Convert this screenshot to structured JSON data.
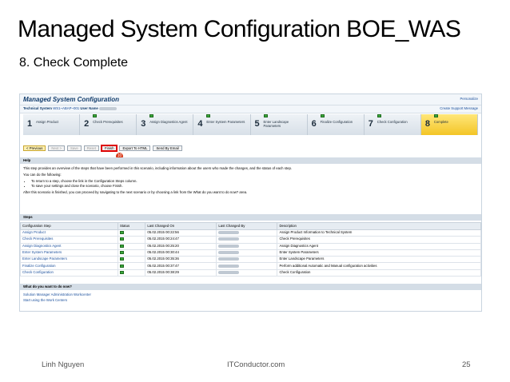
{
  "slide": {
    "title": "Managed System Configuration BOE_WAS",
    "subtitle": "8. Check Complete",
    "footer_left": "Linh Nguyen",
    "footer_center": "ITConductor.com",
    "page_number": "25"
  },
  "app": {
    "title": "Managed System Configuration",
    "personalize": "Personalize",
    "tech_system_label": "Technical System",
    "tech_system_value": "WS1~ABAP~001",
    "user_name_label": "User Name",
    "create_support_message": "Create Support Message"
  },
  "roadmap": [
    {
      "num": "1",
      "label": "Assign Product",
      "done": false,
      "active": false
    },
    {
      "num": "2",
      "label": "Check Prerequisites",
      "done": true,
      "active": false
    },
    {
      "num": "3",
      "label": "Assign Diagnostics Agent",
      "done": true,
      "active": false
    },
    {
      "num": "4",
      "label": "Enter System Parameters",
      "done": true,
      "active": false
    },
    {
      "num": "5",
      "label": "Enter Landscape Parameters",
      "done": true,
      "active": false
    },
    {
      "num": "6",
      "label": "Finalize Configuration",
      "done": true,
      "active": false
    },
    {
      "num": "7",
      "label": "Check Configuration",
      "done": true,
      "active": false
    },
    {
      "num": "8",
      "label": "Complete",
      "done": true,
      "active": true
    }
  ],
  "toolbar": {
    "previous": "< Previous",
    "next": "Next >",
    "save": "Save",
    "reset": "Reset",
    "finish": "Finish",
    "export_html": "Export To HTML",
    "send_email": "Send By Email"
  },
  "callout_number": "10",
  "help": {
    "section_title": "Help",
    "p1": "This step provides an overview of the steps that have been performed in this scenario, including information about the users who made the changes, and the status of each step.",
    "p2": "You can do the following:",
    "bullet1": "To return to a step, choose the link in the Configuration Steps column.",
    "bullet2": "To save your settings and close the scenario, choose Finish.",
    "p3": "After this scenario is finished, you can proceed by navigating to the next scenario or by choosing a link from the What do you want to do now? area."
  },
  "steps": {
    "section_title": "Steps",
    "columns": [
      "Configuration Step",
      "Status",
      "Last Changed On",
      "Last Changed By",
      "Description"
    ],
    "rows": [
      {
        "step": "Assign Product",
        "changed_on": "05.02.2015 00:22:56",
        "description": "Assign Product Information to Technical System"
      },
      {
        "step": "Check Prerequisites",
        "changed_on": "05.02.2015 00:24:47",
        "description": "Check Prerequisites"
      },
      {
        "step": "Assign Diagnostics Agent",
        "changed_on": "05.02.2015 00:25:20",
        "description": "Assign Diagnostics Agent"
      },
      {
        "step": "Enter System Parameters",
        "changed_on": "05.02.2015 00:30:44",
        "description": "Enter System Parameters"
      },
      {
        "step": "Enter Landscape Parameters",
        "changed_on": "05.02.2015 00:35:36",
        "description": "Enter Landscape Parameters"
      },
      {
        "step": "Finalize Configuration",
        "changed_on": "05.02.2015 00:37:47",
        "description": "Perform additional Automatic and Manual configuration activities"
      },
      {
        "step": "Check Configuration",
        "changed_on": "05.02.2015 00:38:29",
        "description": "Check Configuration"
      }
    ]
  },
  "todo": {
    "section_title": "What do you want to do now?",
    "link1": "Solution Manager Administration Workcenter",
    "link2": "Start using the Work Centers"
  },
  "colors": {
    "accent_blue": "#123d6d",
    "link_blue": "#1a4f9c",
    "active_step": "#f3c526",
    "status_green": "#3aa83a",
    "callout_red": "#d93a1a"
  }
}
